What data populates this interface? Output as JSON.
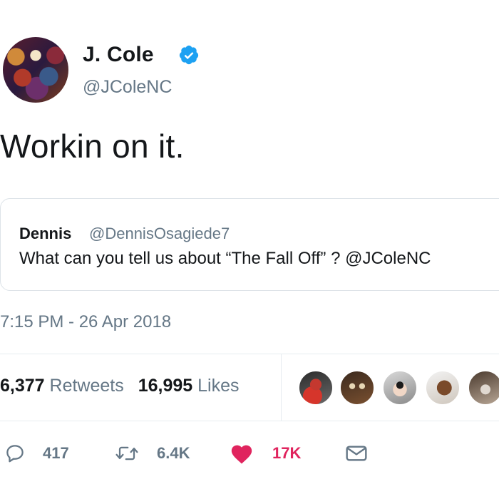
{
  "author": {
    "name": "J. Cole",
    "handle": "@JColeNC",
    "verified": true,
    "avatar_icon": "album-art-avatar"
  },
  "tweet": {
    "text": "Workin on it.",
    "timestamp": "7:15 PM - 26 Apr 2018"
  },
  "quoted_tweet": {
    "name": "Dennis",
    "handle": "@DennisOsagiede7",
    "text": "What can you tell us about “The Fall Off” ? @JColeNC"
  },
  "stats": {
    "retweets_count": "6,377",
    "retweets_label": "Retweets",
    "likes_count": "16,995",
    "likes_label": "Likes"
  },
  "likers": [
    "liker-avatar-1",
    "liker-avatar-2",
    "liker-avatar-3",
    "liker-avatar-4",
    "liker-avatar-5"
  ],
  "actions": {
    "reply_count": "417",
    "retweet_count": "6.4K",
    "like_count": "17K"
  },
  "colors": {
    "text_primary": "#14171a",
    "text_secondary": "#657786",
    "verified_blue": "#1da1f2",
    "like_red": "#e0245e",
    "divider": "#e6ecf0"
  }
}
